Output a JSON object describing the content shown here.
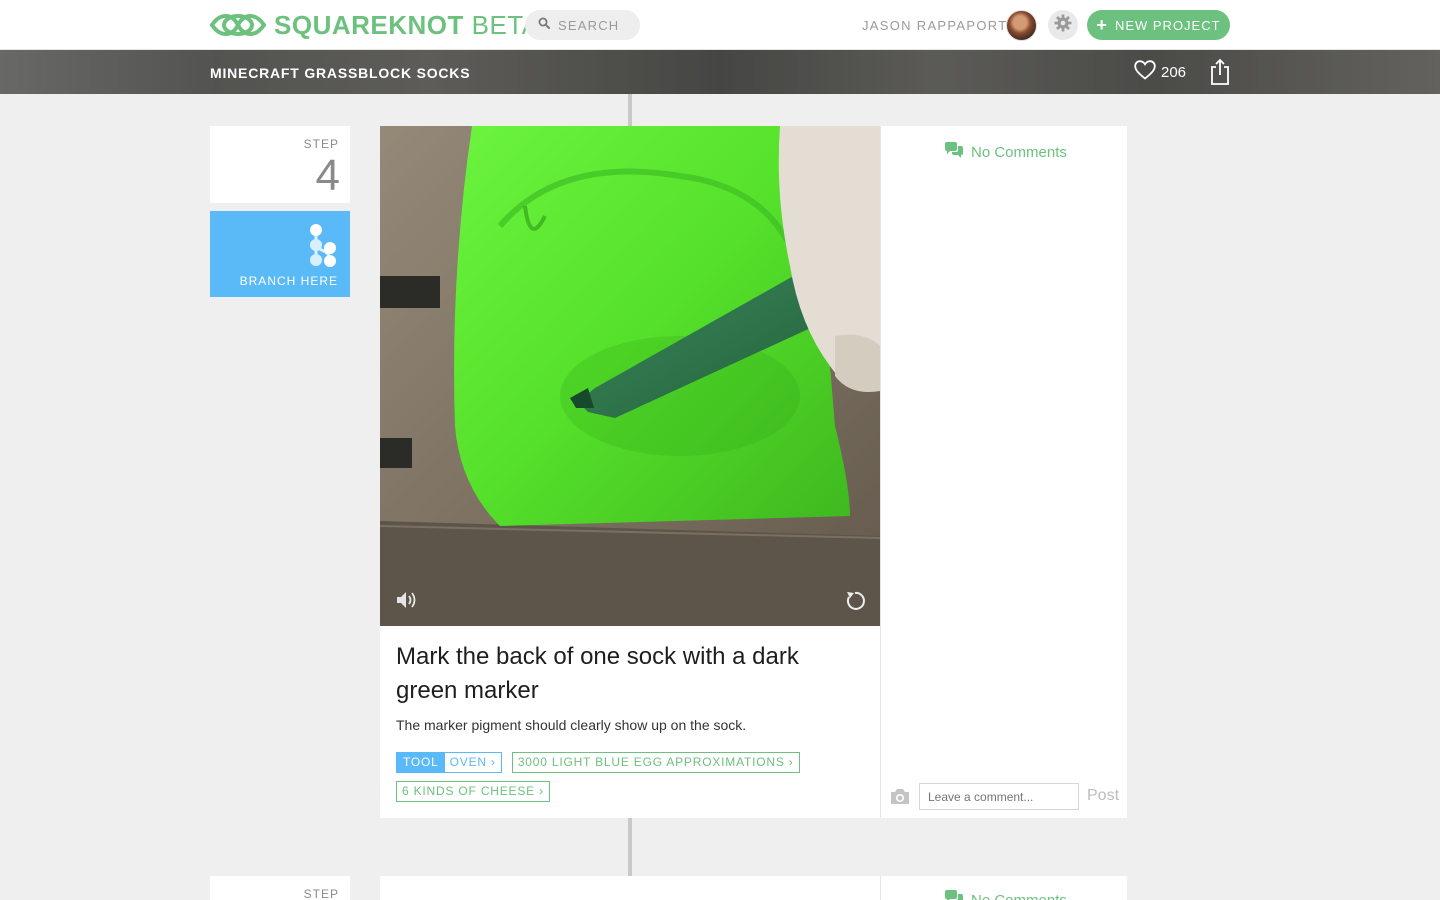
{
  "brand": {
    "name": "SQUAREKNOT",
    "tag": "BETA"
  },
  "nav": {
    "search_label": "SEARCH",
    "username": "JASON RAPPAPORT",
    "new_project_label": "NEW PROJECT"
  },
  "project": {
    "title": "MINECRAFT GRASSBLOCK SOCKS",
    "likes": "206"
  },
  "step": {
    "label": "STEP",
    "number": "4",
    "branch_label": "BRANCH HERE",
    "title": "Mark the back of one sock with a dark green marker",
    "description": "The marker pigment should clearly show up on the sock.",
    "tool_tag": {
      "label": "TOOL",
      "value": "OVEN"
    },
    "tags": [
      "3000 LIGHT BLUE EGG APPROXIMATIONS",
      "6 KINDS OF CHEESE"
    ]
  },
  "comments": {
    "empty_label": "No Comments",
    "placeholder": "Leave a comment...",
    "post_label": "Post"
  },
  "next_step": {
    "label": "STEP",
    "comments_label": "No Comments"
  },
  "colors": {
    "brand_green": "#6cc17e",
    "branch_blue": "#5ab9f7",
    "background": "#efefef"
  },
  "icons": [
    "knot-logo-icon",
    "search-icon",
    "gear-icon",
    "plus-icon",
    "heart-icon",
    "share-icon",
    "branch-icon",
    "volume-icon",
    "replay-icon",
    "chat-bubbles-icon",
    "camera-icon",
    "chevron-right-icon"
  ]
}
